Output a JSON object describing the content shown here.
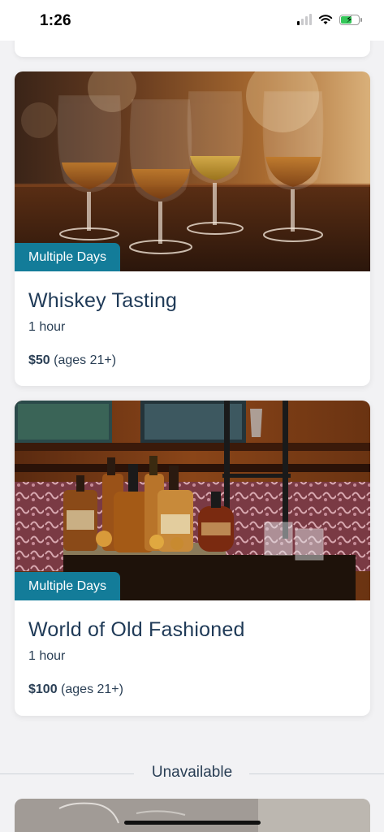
{
  "status_bar": {
    "time": "1:26"
  },
  "cards": [
    {
      "badge": "Multiple Days",
      "title": "Whiskey Tasting",
      "duration": "1 hour",
      "price": "$50",
      "age_note": " (ages 21+)"
    },
    {
      "badge": "Multiple Days",
      "title": "World of Old Fashioned",
      "duration": "1 hour",
      "price": "$100",
      "age_note": " (ages 21+)"
    }
  ],
  "section_divider": {
    "label": "Unavailable"
  },
  "colors": {
    "badge": "#137c99",
    "title": "#1f3a57",
    "background": "#f2f2f4"
  }
}
